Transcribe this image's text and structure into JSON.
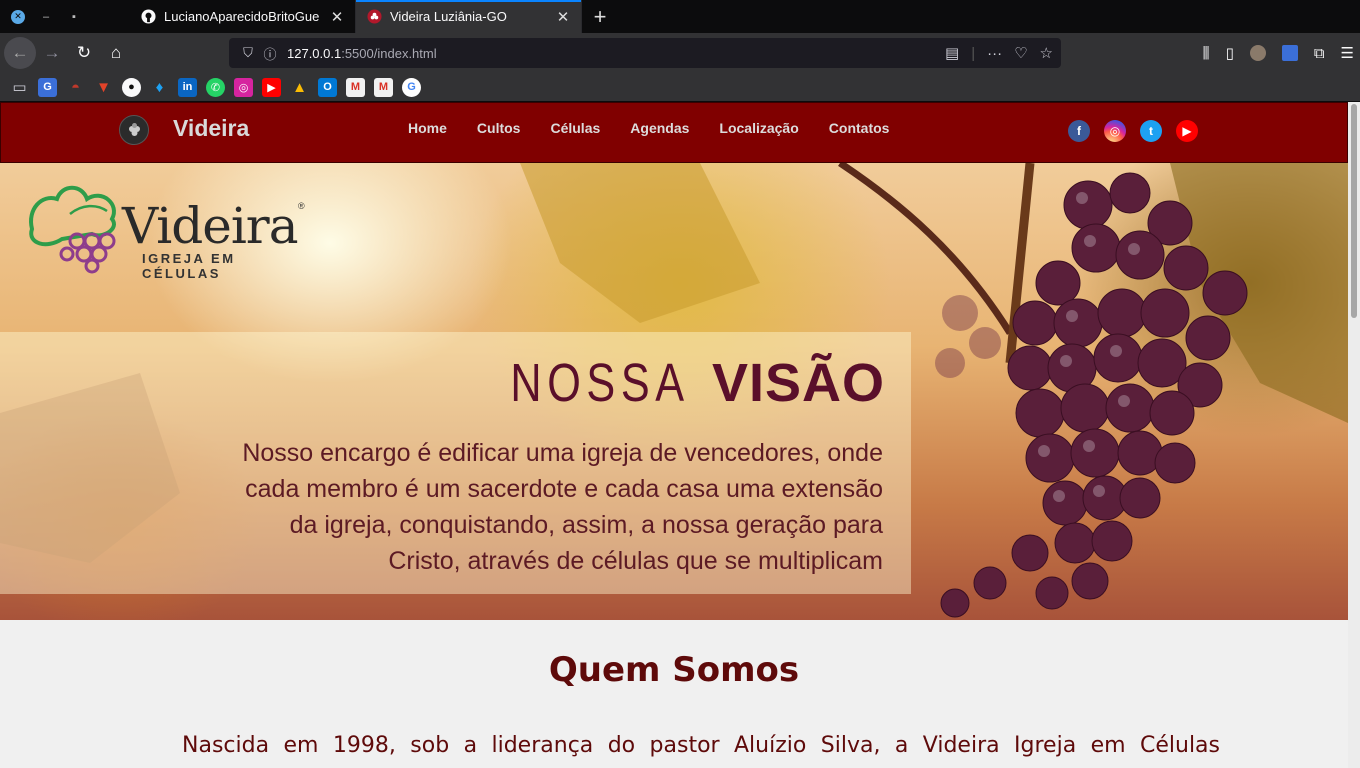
{
  "browser": {
    "tabs": [
      {
        "title": "LucianoAparecidoBritoGue",
        "favicon": "github-icon",
        "active": false
      },
      {
        "title": "Videira Luziânia-GO",
        "favicon": "videira-icon",
        "active": true
      }
    ],
    "new_tab": "+",
    "url_host": "127.0.0.1",
    "url_path": ":5500/index.html",
    "bookmarks": [
      "folder",
      "translate",
      "speedometer",
      "gitlab",
      "github",
      "twitter",
      "linkedin",
      "whatsapp",
      "instagram",
      "youtube",
      "drive",
      "outlook",
      "gmail",
      "gmail-2",
      "google"
    ]
  },
  "site": {
    "brand": "Videira",
    "menu": [
      "Home",
      "Cultos",
      "Células",
      "Agendas",
      "Localização",
      "Contatos"
    ],
    "social": [
      "facebook-icon",
      "instagram-icon",
      "twitter-icon",
      "youtube-icon"
    ],
    "colors": {
      "header": "#800000",
      "accent": "#5e0a0a"
    }
  },
  "hero": {
    "logo_word": "Videira",
    "logo_reg": "®",
    "logo_sub": "IGREJA EM CÉLULAS",
    "title_thin": "NOSSA",
    "title_bold": "VISÃO",
    "text_lines": [
      "Nosso encargo é edificar uma igreja de vencedores, onde",
      "cada membro é um sacerdote e cada casa uma extensão",
      "da igreja, conquistando, assim, a nossa geração para",
      "Cristo, através de células que se multiplicam"
    ]
  },
  "about": {
    "title": "Quem Somos",
    "text": "Nascida em 1998, sob a liderança do pastor Aluízio Silva, a Videira Igreja em Células"
  }
}
